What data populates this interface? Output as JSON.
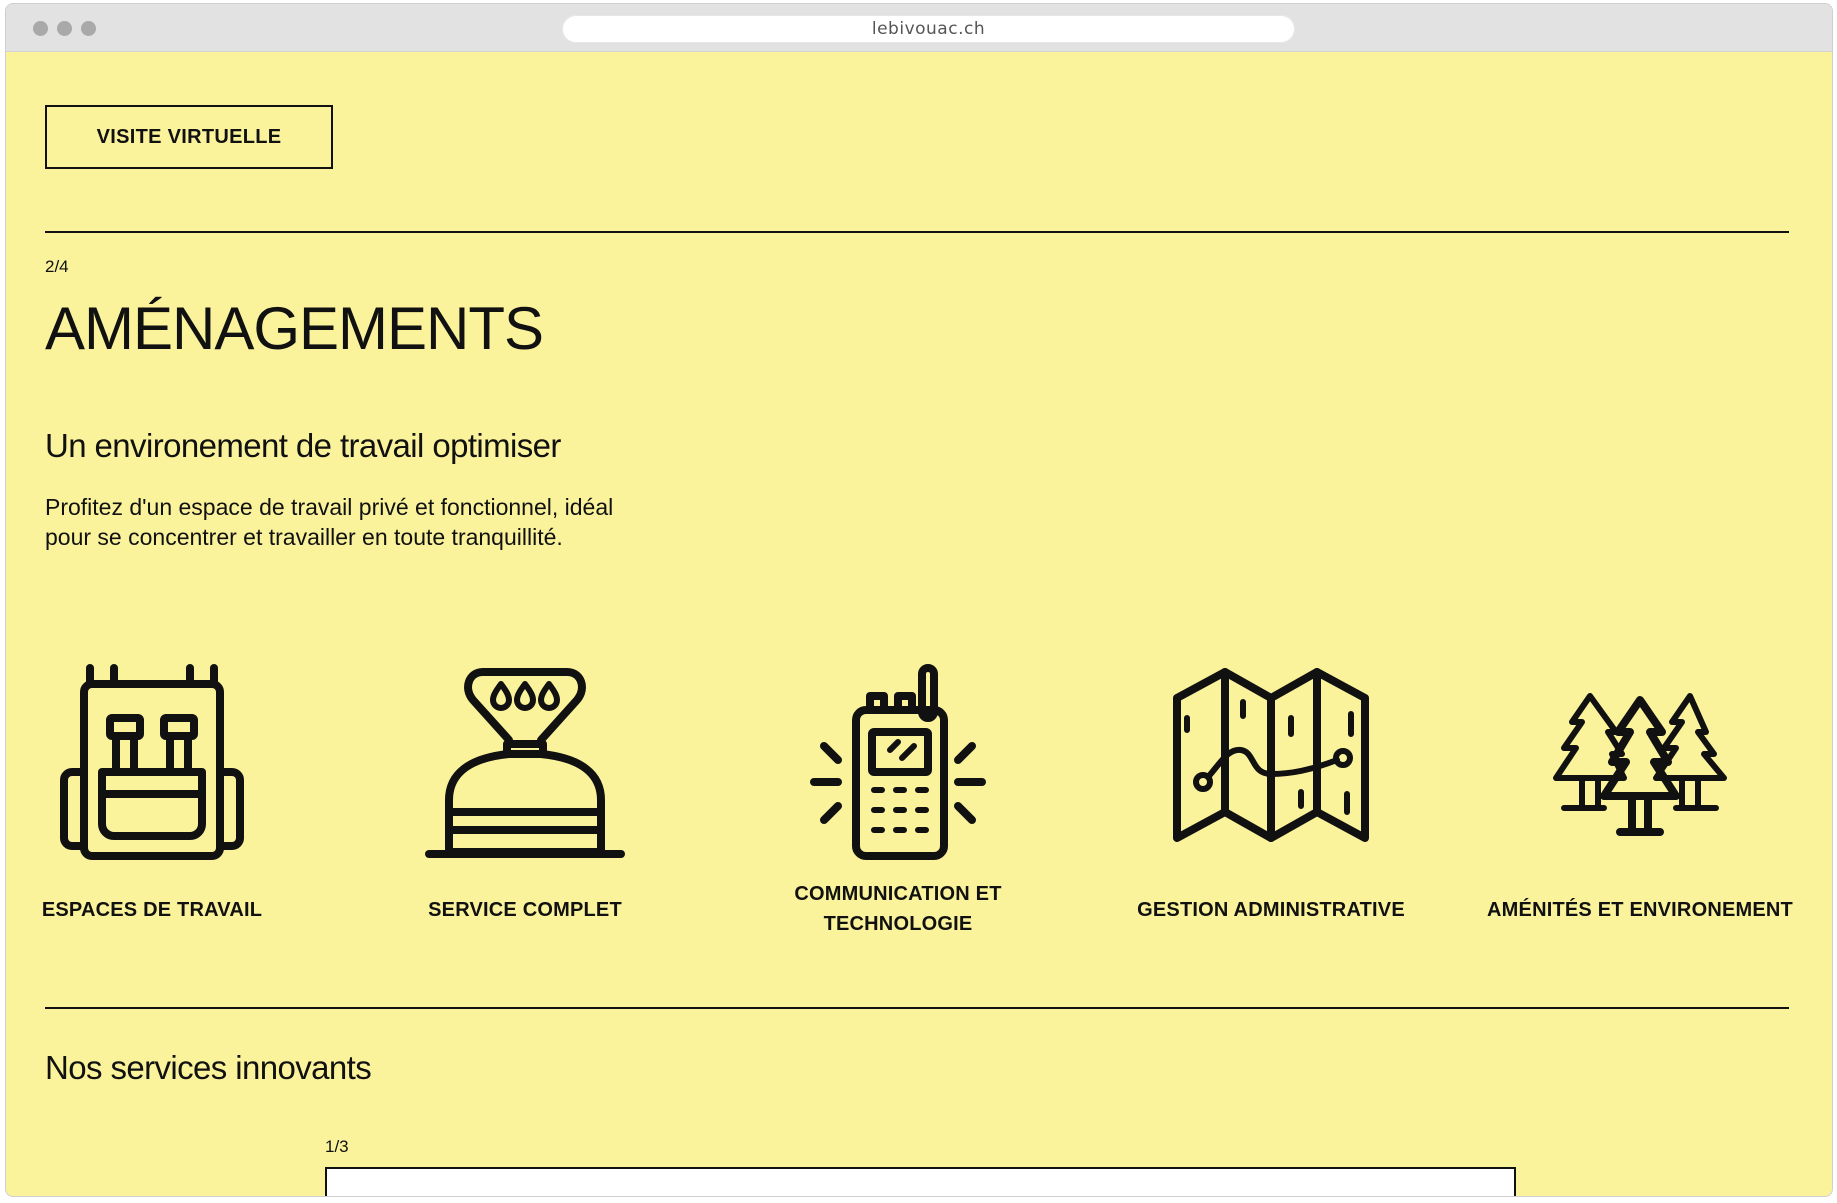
{
  "browser": {
    "url": "lebivouac.ch"
  },
  "page": {
    "visit_button": "VISITE VIRTUELLE",
    "section_counter": "2/4",
    "title": "AMÉNAGEMENTS",
    "subtitle": "Un environement de travail optimiser",
    "description": "Profitez d'un espace de travail privé et fonctionnel, idéal pour se concentrer et travailler en toute tranquillité.",
    "features": [
      {
        "label": "ESPACES DE TRAVAIL",
        "icon": "backpack-icon"
      },
      {
        "label": "SERVICE COMPLET",
        "icon": "camping-stove-icon"
      },
      {
        "label": "COMMUNICATION ET TECHNOLOGIE",
        "icon": "walkie-talkie-icon"
      },
      {
        "label": "GESTION ADMINISTRATIVE",
        "icon": "map-icon"
      },
      {
        "label": "AMÉNITÉS ET ENVIRONEMENT",
        "icon": "trees-icon"
      }
    ],
    "services_title": "Nos services innovants",
    "services_counter": "1/3"
  },
  "colors": {
    "background": "#faf39b",
    "text": "#111111",
    "chrome": "#e2e2e2"
  }
}
